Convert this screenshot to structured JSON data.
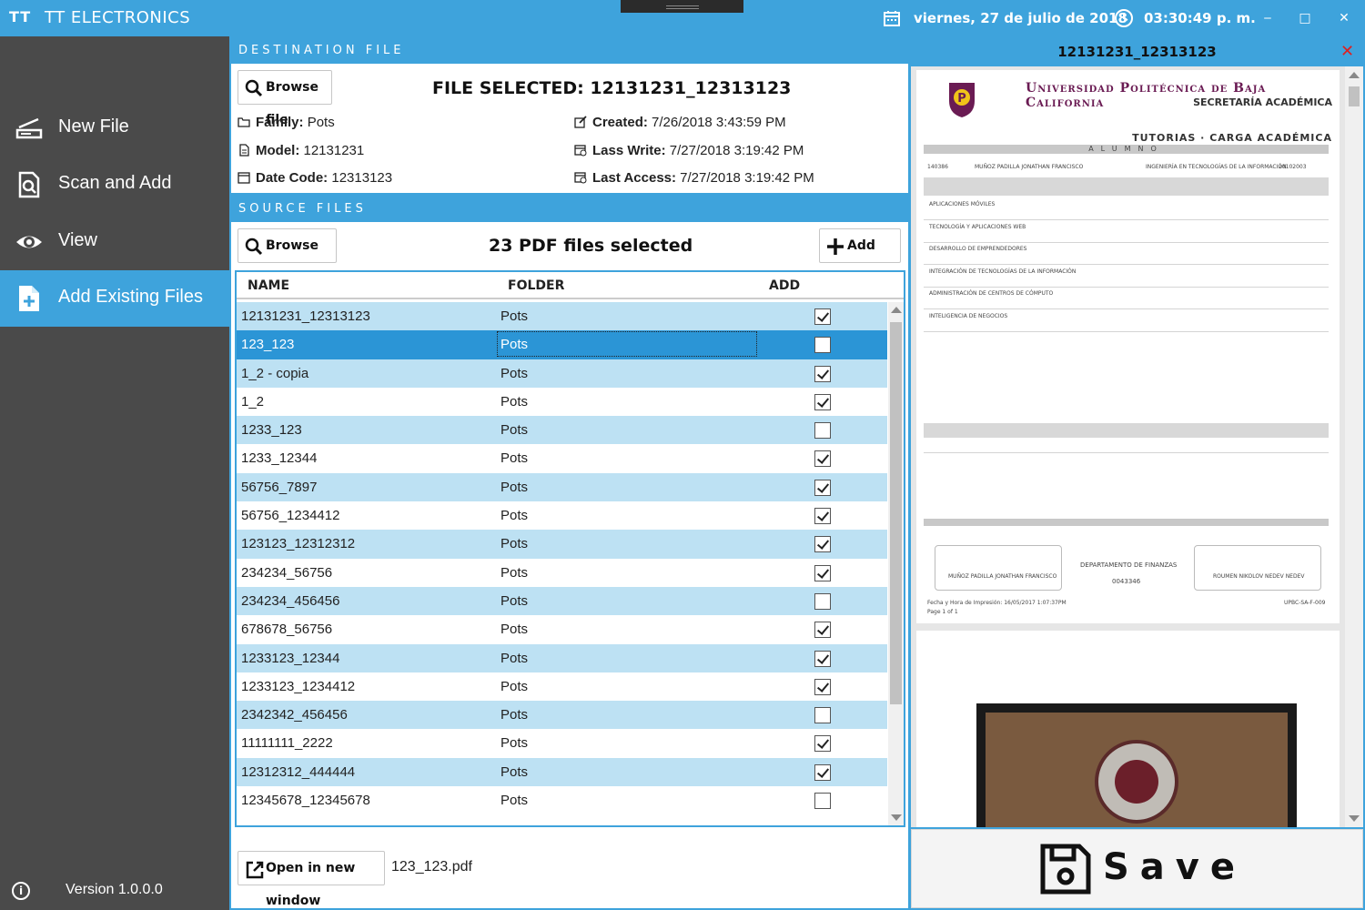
{
  "app": {
    "logo": "TT",
    "title": "TT ELECTRONICS"
  },
  "titlebar": {
    "date": "viernes, 27 de julio de 2018",
    "time": "03:30:49 p. m.",
    "minimize": "‒",
    "maximize": "□",
    "close": "✕"
  },
  "sidebar": {
    "items": [
      {
        "label": "New File",
        "icon": "scanner-icon"
      },
      {
        "label": "Scan and Add",
        "icon": "scan-search-icon"
      },
      {
        "label": "View",
        "icon": "eye-icon"
      },
      {
        "label": "Add Existing Files",
        "icon": "file-add-icon",
        "active": true
      }
    ],
    "version": "Version 1.0.0.0"
  },
  "destination": {
    "header": "DESTINATION FILE",
    "browse_label": "Browse file",
    "title": "FILE SELECTED: 12131231_12313123",
    "family_label": "Family:",
    "family": "Pots",
    "model_label": "Model:",
    "model": "12131231",
    "datecode_label": "Date Code:",
    "datecode": "12313123",
    "created_label": "Created:",
    "created": "7/26/2018 3:43:59 PM",
    "lastwrite_label": "Lass Write:",
    "lastwrite": "7/27/2018 3:19:42 PM",
    "lastaccess_label": "Last Access:",
    "lastaccess": "7/27/2018 3:19:42 PM"
  },
  "source": {
    "header": "SOURCE FILES",
    "browse_label": "Browse files",
    "summary": "23 PDF files selected",
    "add_label": "Add files",
    "columns": {
      "name": "NAME",
      "folder": "FOLDER",
      "add": "ADD"
    },
    "rows": [
      {
        "name": "12131231_12313123",
        "folder": "Pots",
        "add": true
      },
      {
        "name": "123_123",
        "folder": "Pots",
        "add": false,
        "selected": true
      },
      {
        "name": "1_2 - copia",
        "folder": "Pots",
        "add": true
      },
      {
        "name": "1_2",
        "folder": "Pots",
        "add": true
      },
      {
        "name": "1233_123",
        "folder": "Pots",
        "add": false
      },
      {
        "name": "1233_12344",
        "folder": "Pots",
        "add": true
      },
      {
        "name": "56756_7897",
        "folder": "Pots",
        "add": true
      },
      {
        "name": "56756_1234412",
        "folder": "Pots",
        "add": true
      },
      {
        "name": "123123_12312312",
        "folder": "Pots",
        "add": true
      },
      {
        "name": "234234_56756",
        "folder": "Pots",
        "add": true
      },
      {
        "name": "234234_456456",
        "folder": "Pots",
        "add": false
      },
      {
        "name": "678678_56756",
        "folder": "Pots",
        "add": true
      },
      {
        "name": "1233123_12344",
        "folder": "Pots",
        "add": true
      },
      {
        "name": "1233123_1234412",
        "folder": "Pots",
        "add": true
      },
      {
        "name": "2342342_456456",
        "folder": "Pots",
        "add": false
      },
      {
        "name": "11111111_2222",
        "folder": "Pots",
        "add": true
      },
      {
        "name": "12312312_444444",
        "folder": "Pots",
        "add": true
      },
      {
        "name": "12345678_12345678",
        "folder": "Pots",
        "add": false
      }
    ],
    "open_label": "Open in new window",
    "current_file": "123_123.pdf"
  },
  "preview": {
    "title": "12131231_12313123",
    "close": "✕",
    "doc": {
      "university": "Universidad Politécnica de Baja California",
      "department": "SECRETARÍA ACADÉMICA",
      "section": "TUTORIAS · CARGA ACADÉMICA",
      "bar": "ALUMNO",
      "student": "MUÑOZ PADILLA JONATHAN FRANCISCO",
      "program": "INGENIERÍA EN TECNOLOGÍAS DE LA INFORMACIÓN",
      "matricula": "140386",
      "plan": "20102003",
      "courses": [
        "APLICACIONES MÓVILES",
        "TECNOLOGÍA Y APLICACIONES WEB",
        "DESARROLLO DE EMPRENDEDORES",
        "INTEGRACIÓN DE TECNOLOGÍAS DE LA INFORMACIÓN",
        "ADMINISTRACIÓN DE CENTROS DE CÓMPUTO",
        "INTELIGENCIA DE NEGOCIOS"
      ],
      "finance": "DEPARTAMENTO DE FINANZAS",
      "folio": "0043346",
      "tutor": "ROUMEN NIKOLOV NEDEV NEDEV",
      "printed": "Fecha y Hora de Impresión: 16/05/2017 1:07:37PM",
      "page": "Page 1 of 1",
      "code": "UPBC-SA-F-009"
    }
  },
  "save_label": "Save"
}
